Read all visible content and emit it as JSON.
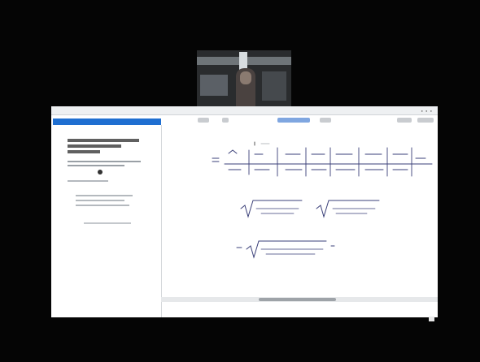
{
  "webcam": {
    "label": ""
  },
  "window": {
    "title": ""
  },
  "side_panel": {
    "tab_label": "",
    "heading": "",
    "radio_selected": true
  },
  "toolbar": {
    "items": [
      "",
      "",
      "",
      "",
      "",
      ""
    ]
  },
  "board": {
    "description_text": ""
  },
  "colors": {
    "background": "#050505",
    "accent": "#1f6fd1",
    "ink": "#3a3f78"
  }
}
